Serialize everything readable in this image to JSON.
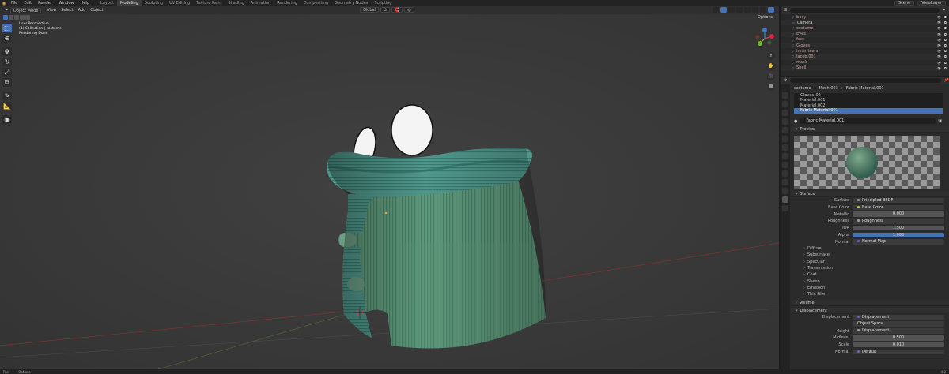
{
  "topbar": {
    "menus": [
      "File",
      "Edit",
      "Render",
      "Window",
      "Help"
    ],
    "workspaces": [
      "Layout",
      "Modeling",
      "Sculpting",
      "UV Editing",
      "Texture Paint",
      "Shading",
      "Animation",
      "Rendering",
      "Compositing",
      "Geometry Nodes",
      "Scripting"
    ],
    "active_workspace": "Modeling",
    "scene": "Scene",
    "view_layer": "ViewLayer"
  },
  "viewport": {
    "mode": "Object Mode",
    "menus": [
      "View",
      "Select",
      "Add",
      "Object"
    ],
    "orientation": "Global",
    "options": "Options",
    "info": {
      "view": "User Perspective",
      "collection": "(1) Collection | costume",
      "status": "Rendering Done"
    }
  },
  "outliner": {
    "search_placeholder": "",
    "items": [
      {
        "name": "body",
        "kind": "mesh"
      },
      {
        "name": "Camera",
        "kind": "camera"
      },
      {
        "name": "costume",
        "kind": "mesh"
      },
      {
        "name": "Eyes",
        "kind": "mesh"
      },
      {
        "name": "feet",
        "kind": "mesh"
      },
      {
        "name": "Gloves",
        "kind": "mesh"
      },
      {
        "name": "inner tears",
        "kind": "mesh"
      },
      {
        "name": "Jacob.001",
        "kind": "mesh"
      },
      {
        "name": "mask",
        "kind": "mesh"
      },
      {
        "name": "Shell",
        "kind": "mesh"
      }
    ]
  },
  "properties": {
    "breadcrumb": [
      "costume",
      "Mesh.003",
      "Fabric Material.001"
    ],
    "slots": [
      "Gloves_02",
      "Material.001",
      "Material.002",
      "Fabric Material.001"
    ],
    "selected_slot": 3,
    "material_name": "Fabric Material.001",
    "preview_label": "Preview",
    "surface_label": "Surface",
    "surface_rows": [
      {
        "label": "Surface",
        "value": "Principled BSDF",
        "dot": "gry"
      },
      {
        "label": "Base Color",
        "value": "Base Color",
        "dot": "yel"
      },
      {
        "label": "Metallic",
        "value": "0.000",
        "num": true
      },
      {
        "label": "Roughness",
        "value": "Roughness",
        "dot": "gry"
      },
      {
        "label": "IOR",
        "value": "1.500",
        "num": true
      },
      {
        "label": "Alpha",
        "value": "1.000",
        "num": true,
        "blue": true
      },
      {
        "label": "Normal",
        "value": "Normal Map",
        "dot": "blu"
      }
    ],
    "subpanels": [
      "Diffuse",
      "Subsurface",
      "Specular",
      "Transmission",
      "Coat",
      "Sheen",
      "Emission",
      "Thin Film"
    ],
    "volume_label": "Volume",
    "displacement_label": "Displacement",
    "disp_rows": [
      {
        "label": "Displacement",
        "value": "Displacement",
        "dot": "blu"
      },
      {
        "label": "",
        "value": "Object Space"
      },
      {
        "label": "Height",
        "value": "Displacement",
        "dot": "gry"
      },
      {
        "label": "Midlevel",
        "value": "0.500",
        "num": true
      },
      {
        "label": "Scale",
        "value": "0.010",
        "num": true
      },
      {
        "label": "Normal",
        "value": "Default",
        "dot": "blu"
      }
    ]
  },
  "statusbar": {
    "left": "Pan",
    "mid": "Options",
    "version": "4.2"
  },
  "colors": {
    "accent": "#4772b3",
    "fabric": "#3f8f86"
  }
}
